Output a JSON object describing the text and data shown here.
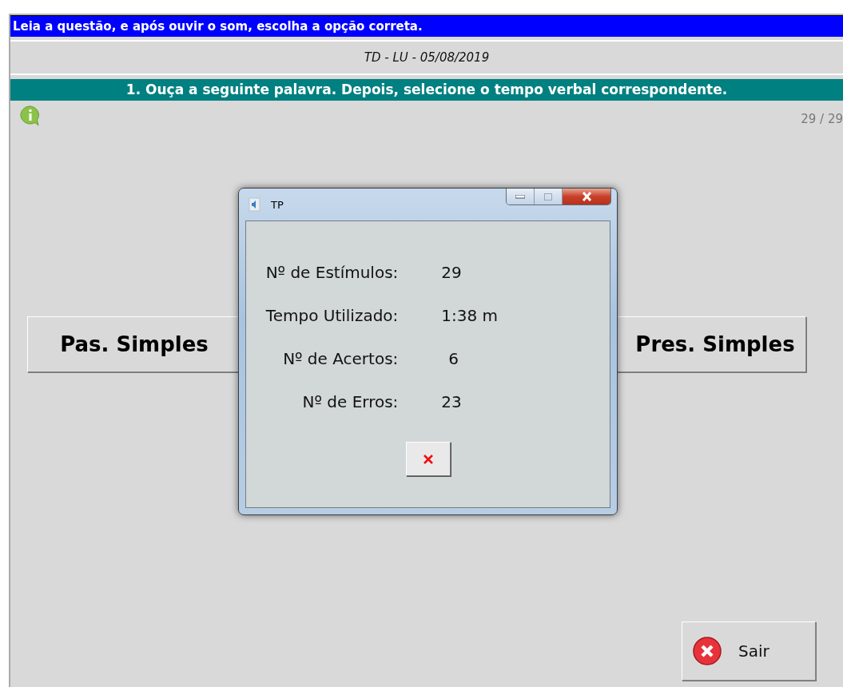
{
  "instruction_bar": "Leia a questão, e após ouvir o som, escolha a opção correta.",
  "session_label": "TD - LU - 05/08/2019",
  "question_bar": "1. Ouça a seguinte palavra. Depois, selecione o tempo verbal correspondente.",
  "counter": "29 / 29",
  "options": [
    {
      "label": "Pas. Simples"
    },
    {
      "label": "Pres. Simples"
    }
  ],
  "exit_button": "Sair",
  "dialog": {
    "title": "TP",
    "stats": [
      {
        "label": "Nº de Estímulos:",
        "value": "29"
      },
      {
        "label": "Tempo Utilizado:",
        "value": "1:38 m"
      },
      {
        "label": "Nº de Acertos:",
        "value": "6"
      },
      {
        "label": "Nº de Erros:",
        "value": "23"
      }
    ]
  }
}
